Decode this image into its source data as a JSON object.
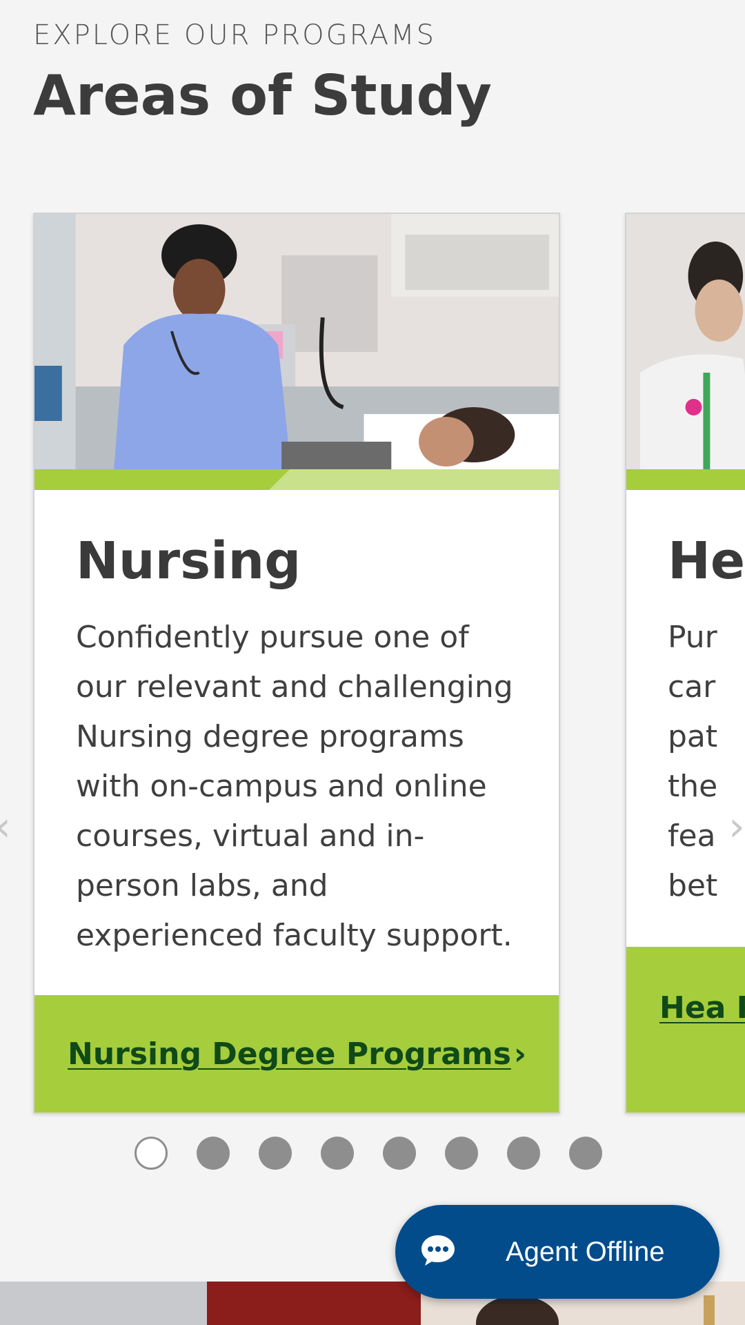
{
  "section": {
    "eyebrow": "EXPLORE OUR PROGRAMS",
    "heading": "Areas of Study"
  },
  "cards": [
    {
      "title": "Nursing",
      "description": "Confidently pursue one of our relevant and challenging Nursing degree programs with on-campus and online courses, virtual and in-person labs, and experienced faculty support.",
      "cta_label": "Nursing Degree Programs",
      "cta_icon": "chevron-right-icon"
    },
    {
      "title": "He",
      "description": "Pur\ncar\npat\nthe\nfea\nbet",
      "cta_label": "Hea Pro"
    }
  ],
  "carousel": {
    "prev_icon": "chevron-left-icon",
    "next_icon": "chevron-right-icon",
    "dots_count": 8,
    "active_dot_index": 0
  },
  "chat": {
    "label": "Agent Offline",
    "icon": "chat-bubble-icon"
  },
  "colors": {
    "accent_green": "#a6cd3c",
    "link_green": "#0f4a18",
    "chat_blue": "#034c8c",
    "background": "#f4f4f5"
  }
}
